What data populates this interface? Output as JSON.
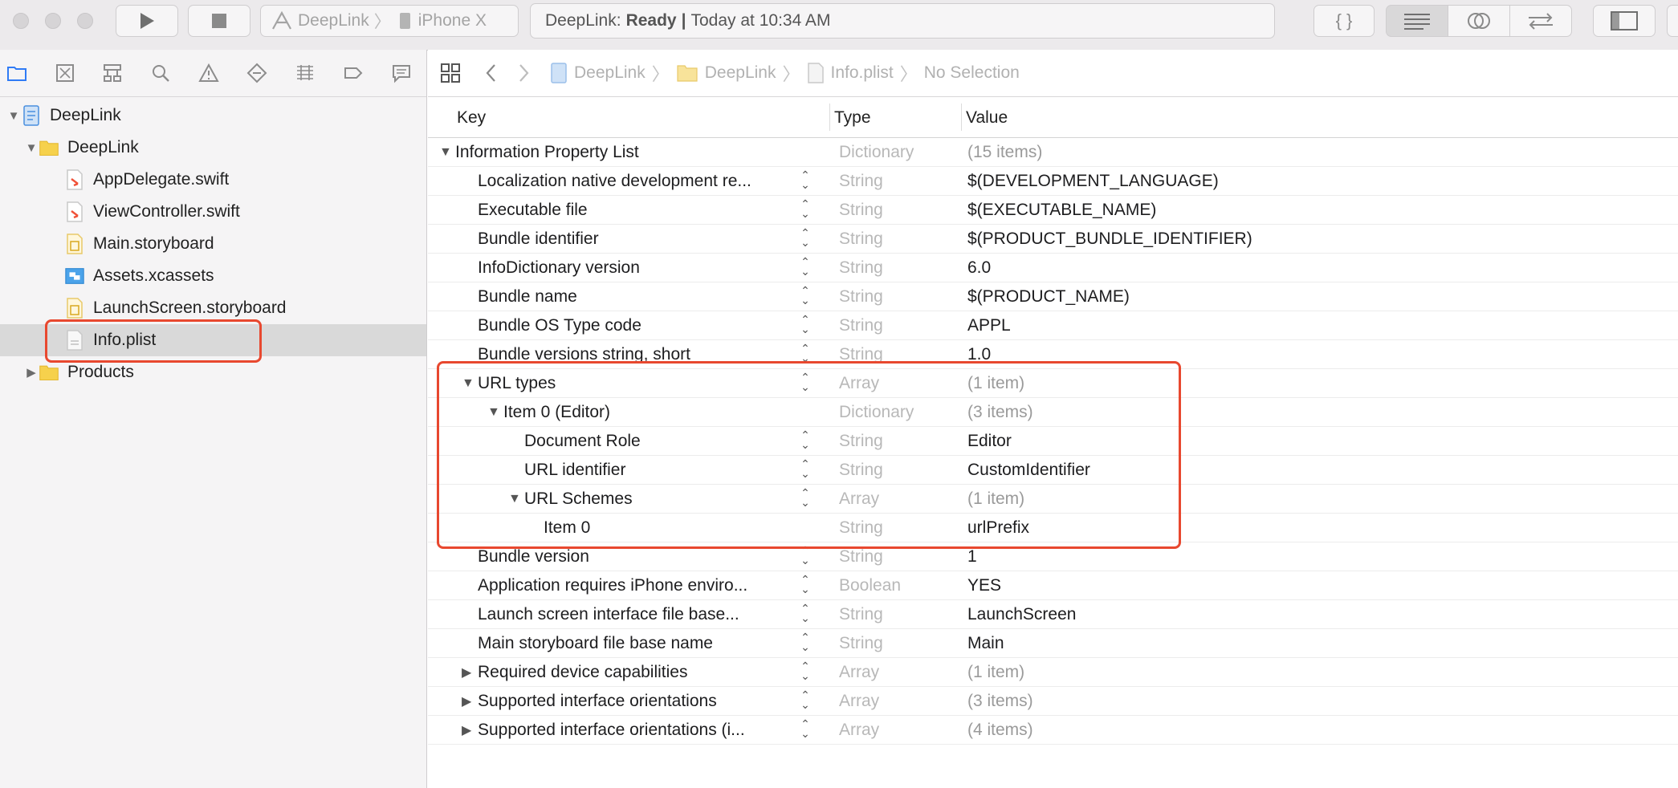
{
  "toolbar": {
    "scheme": {
      "target": "DeepLink",
      "device": "iPhone X"
    },
    "status": {
      "project": "DeepLink:",
      "state": "Ready",
      "separator": "|",
      "time": "Today at 10:34 AM"
    },
    "code_label": "{ }"
  },
  "navigator": {
    "tabs": [
      "project-navigator",
      "source-control-navigator",
      "symbol-navigator",
      "find-navigator",
      "issue-navigator",
      "test-navigator",
      "debug-navigator",
      "breakpoint-navigator",
      "report-navigator"
    ],
    "tree": [
      {
        "label": "DeepLink",
        "icon": "xcodeproj-icon",
        "depth": 0,
        "disclosure": "open"
      },
      {
        "label": "DeepLink",
        "icon": "folder-icon",
        "depth": 1,
        "disclosure": "open"
      },
      {
        "label": "AppDelegate.swift",
        "icon": "swift-file-icon",
        "depth": 2,
        "disclosure": "none"
      },
      {
        "label": "ViewController.swift",
        "icon": "swift-file-icon",
        "depth": 2,
        "disclosure": "none"
      },
      {
        "label": "Main.storyboard",
        "icon": "storyboard-icon",
        "depth": 2,
        "disclosure": "none"
      },
      {
        "label": "Assets.xcassets",
        "icon": "asset-catalog-icon",
        "depth": 2,
        "disclosure": "none"
      },
      {
        "label": "LaunchScreen.storyboard",
        "icon": "storyboard-icon",
        "depth": 2,
        "disclosure": "none"
      },
      {
        "label": "Info.plist",
        "icon": "plist-file-icon",
        "depth": 2,
        "disclosure": "none",
        "selected": true
      },
      {
        "label": "Products",
        "icon": "folder-icon",
        "depth": 1,
        "disclosure": "closed"
      }
    ]
  },
  "jumpbar": {
    "crumbs": [
      "DeepLink",
      "DeepLink",
      "Info.plist",
      "No Selection"
    ]
  },
  "plist": {
    "headers": {
      "key": "Key",
      "type": "Type",
      "value": "Value"
    },
    "rows": [
      {
        "key": "Information Property List",
        "type": "Dictionary",
        "value": "(15 items)",
        "depth": 0,
        "disclosure": "open",
        "stepper": false,
        "dim": true
      },
      {
        "key": "Localization native development re...",
        "type": "String",
        "value": "$(DEVELOPMENT_LANGUAGE)",
        "depth": 1,
        "disclosure": "none",
        "stepper": true
      },
      {
        "key": "Executable file",
        "type": "String",
        "value": "$(EXECUTABLE_NAME)",
        "depth": 1,
        "disclosure": "none",
        "stepper": true
      },
      {
        "key": "Bundle identifier",
        "type": "String",
        "value": "$(PRODUCT_BUNDLE_IDENTIFIER)",
        "depth": 1,
        "disclosure": "none",
        "stepper": true
      },
      {
        "key": "InfoDictionary version",
        "type": "String",
        "value": "6.0",
        "depth": 1,
        "disclosure": "none",
        "stepper": true
      },
      {
        "key": "Bundle name",
        "type": "String",
        "value": "$(PRODUCT_NAME)",
        "depth": 1,
        "disclosure": "none",
        "stepper": true
      },
      {
        "key": "Bundle OS Type code",
        "type": "String",
        "value": "APPL",
        "depth": 1,
        "disclosure": "none",
        "stepper": true
      },
      {
        "key": "Bundle versions string, short",
        "type": "String",
        "value": "1.0",
        "depth": 1,
        "disclosure": "none",
        "stepper": true
      },
      {
        "key": "URL types",
        "type": "Array",
        "value": "(1 item)",
        "depth": 1,
        "disclosure": "open",
        "stepper": true,
        "dim": true
      },
      {
        "key": "Item 0 (Editor)",
        "type": "Dictionary",
        "value": "(3 items)",
        "depth": 2,
        "disclosure": "open",
        "stepper": false,
        "dim": true
      },
      {
        "key": "Document Role",
        "type": "String",
        "value": "Editor",
        "depth": 3,
        "disclosure": "none",
        "stepper": true
      },
      {
        "key": "URL identifier",
        "type": "String",
        "value": "CustomIdentifier",
        "depth": 3,
        "disclosure": "none",
        "stepper": true
      },
      {
        "key": "URL Schemes",
        "type": "Array",
        "value": "(1 item)",
        "depth": 3,
        "disclosure": "open",
        "stepper": true,
        "dim": true
      },
      {
        "key": "Item 0",
        "type": "String",
        "value": "urlPrefix",
        "depth": 4,
        "disclosure": "none",
        "stepper": false
      },
      {
        "key": "Bundle version",
        "type": "String",
        "value": "1",
        "depth": 1,
        "disclosure": "none",
        "stepper": true
      },
      {
        "key": "Application requires iPhone enviro...",
        "type": "Boolean",
        "value": "YES",
        "depth": 1,
        "disclosure": "none",
        "stepper": true
      },
      {
        "key": "Launch screen interface file base...",
        "type": "String",
        "value": "LaunchScreen",
        "depth": 1,
        "disclosure": "none",
        "stepper": true
      },
      {
        "key": "Main storyboard file base name",
        "type": "String",
        "value": "Main",
        "depth": 1,
        "disclosure": "none",
        "stepper": true
      },
      {
        "key": "Required device capabilities",
        "type": "Array",
        "value": "(1 item)",
        "depth": 1,
        "disclosure": "closed",
        "stepper": true,
        "dim": true
      },
      {
        "key": "Supported interface orientations",
        "type": "Array",
        "value": "(3 items)",
        "depth": 1,
        "disclosure": "closed",
        "stepper": true,
        "dim": true
      },
      {
        "key": "Supported interface orientations (i...",
        "type": "Array",
        "value": "(4 items)",
        "depth": 1,
        "disclosure": "closed",
        "stepper": true,
        "dim": true
      }
    ]
  },
  "colors": {
    "highlight": "#e8482f",
    "selection": "#d9d9d9",
    "accent": "#2f7bf5"
  }
}
